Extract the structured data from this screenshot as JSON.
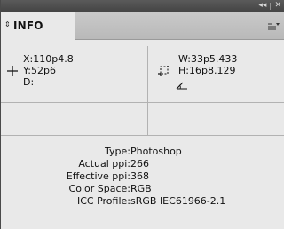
{
  "panel": {
    "title_controls": {
      "collapse_icon": "double-chevron-left-icon",
      "close_icon": "close-icon"
    },
    "tab": {
      "label": "INFO",
      "arrows_icon": "up-down-arrows-icon"
    },
    "menu_icon": "panel-menu-icon"
  },
  "info": {
    "position": {
      "icon": "crosshair-icon",
      "x_label": "X:",
      "x_value": "110p4.8",
      "y_label": "Y:",
      "y_value": "52p6",
      "d_label": "D:"
    },
    "size": {
      "icon": "selection-corners-icon",
      "w_label": "W:",
      "w_value": "33p5.433",
      "h_label": "H:",
      "h_value": "16p8.129",
      "angle_icon": "angle-icon"
    }
  },
  "document_info": [
    {
      "key": "Type:",
      "value": "Photoshop"
    },
    {
      "key": "Actual ppi:",
      "value": "266"
    },
    {
      "key": "Effective ppi:",
      "value": "368"
    },
    {
      "key": "Color Space:",
      "value": "RGB"
    },
    {
      "key": "ICC Profile:",
      "value": "sRGB IEC61966-2.1"
    }
  ]
}
